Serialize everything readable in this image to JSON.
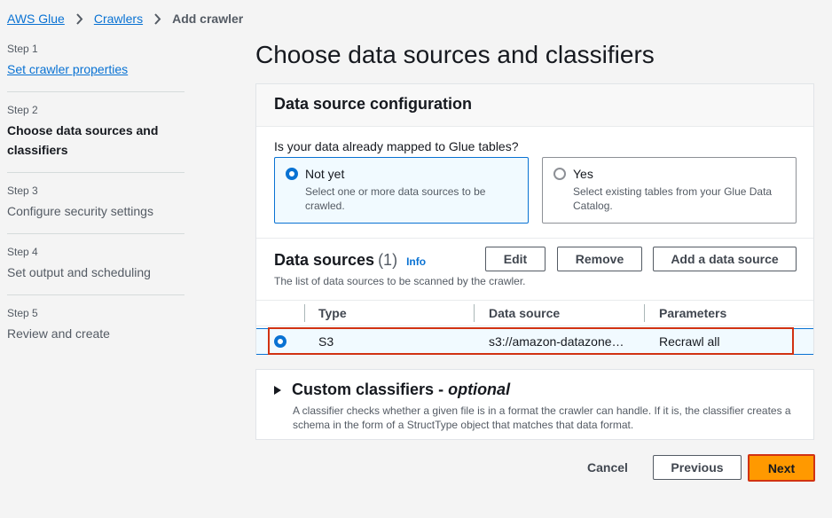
{
  "breadcrumb": {
    "items": [
      "AWS Glue",
      "Crawlers"
    ],
    "current": "Add crawler"
  },
  "steps": [
    {
      "num": "Step 1",
      "title": "Set crawler properties",
      "state": "link"
    },
    {
      "num": "Step 2",
      "title": "Choose data sources and classifiers",
      "state": "active"
    },
    {
      "num": "Step 3",
      "title": "Configure security settings",
      "state": "disabled"
    },
    {
      "num": "Step 4",
      "title": "Set output and scheduling",
      "state": "disabled"
    },
    {
      "num": "Step 5",
      "title": "Review and create",
      "state": "disabled"
    }
  ],
  "page": {
    "title": "Choose data sources and classifiers"
  },
  "config": {
    "header": "Data source configuration",
    "question": "Is your data already mapped to Glue tables?",
    "options": [
      {
        "label": "Not yet",
        "desc": "Select one or more data sources to be crawled.",
        "selected": true
      },
      {
        "label": "Yes",
        "desc": "Select existing tables from your Glue Data Catalog.",
        "selected": false
      }
    ]
  },
  "datasources": {
    "title": "Data sources",
    "count": "(1)",
    "info": "Info",
    "desc": "The list of data sources to be scanned by the crawler.",
    "buttons": {
      "edit": "Edit",
      "remove": "Remove",
      "add": "Add a data source"
    },
    "columns": [
      "Type",
      "Data source",
      "Parameters"
    ],
    "rows": [
      {
        "type": "S3",
        "source": "s3://amazon-datazone…",
        "params": "Recrawl all",
        "selected": true
      }
    ]
  },
  "classifiers": {
    "title": "Custom classifiers - ",
    "title_italic": "optional",
    "desc": "A classifier checks whether a given file is in a format the crawler can handle. If it is, the classifier creates a schema in the form of a StructType object that matches that data format."
  },
  "footer": {
    "cancel": "Cancel",
    "previous": "Previous",
    "next": "Next"
  },
  "colors": {
    "accent": "#0972d3",
    "primary_button": "#ff9900",
    "highlight": "#d13212"
  }
}
